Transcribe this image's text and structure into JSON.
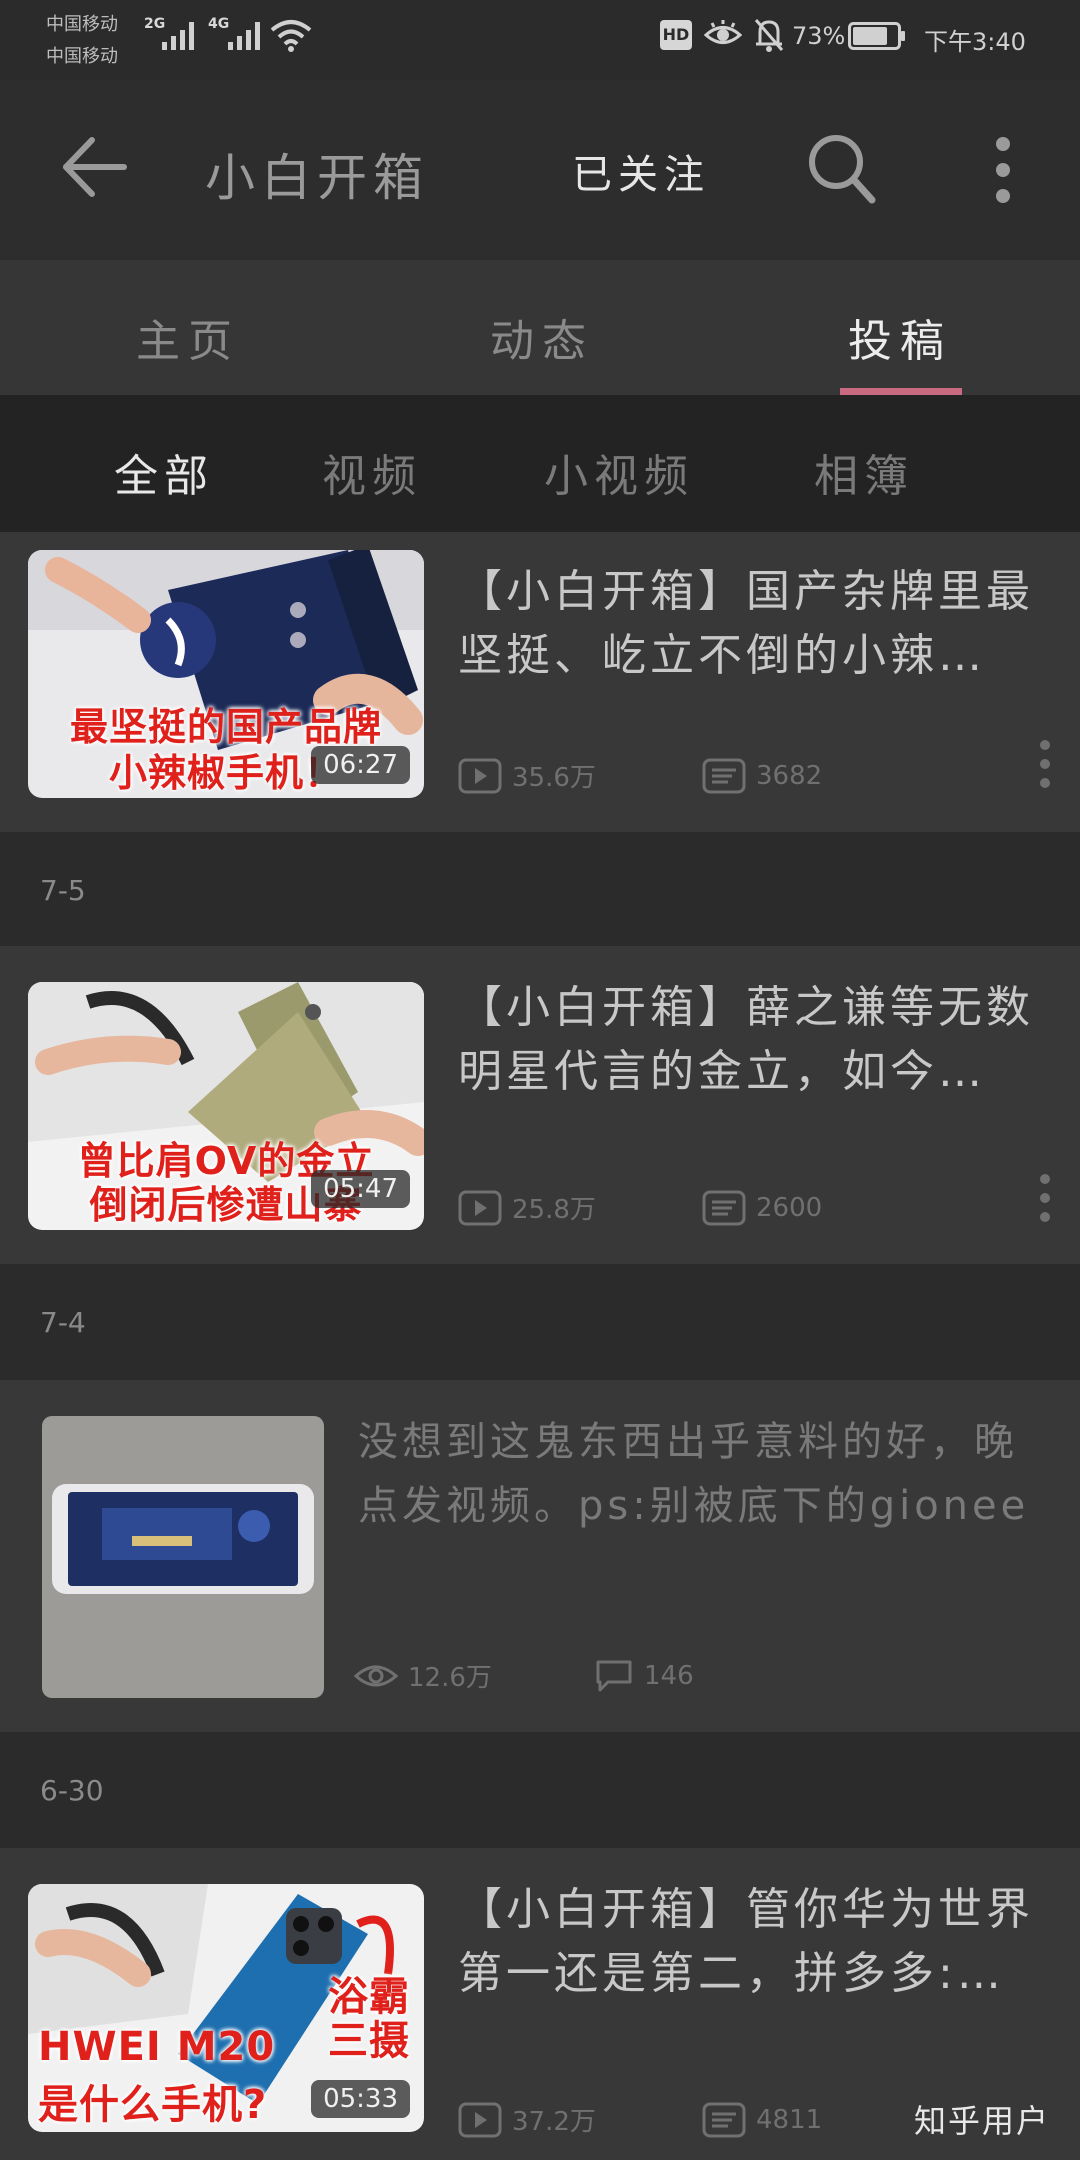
{
  "status": {
    "carrier_1": "中国移动",
    "carrier_2": "中国移动",
    "net_1": "2G",
    "net_2": "4G",
    "hd": "HD",
    "battery": "73%",
    "time": "下午3:40"
  },
  "header": {
    "title": "小白开箱",
    "follow_label": "已关注"
  },
  "main_tabs": [
    {
      "label": "主页"
    },
    {
      "label": "动态"
    },
    {
      "label": "投稿"
    }
  ],
  "sub_tabs": [
    {
      "label": "全部"
    },
    {
      "label": "视频"
    },
    {
      "label": "小视频"
    },
    {
      "label": "相簿"
    }
  ],
  "feed": [
    {
      "title": "【小白开箱】国产杂牌里最坚挺、屹立不倒的小辣…",
      "duration": "06:27",
      "caption_1": "最坚挺的国产品牌",
      "caption_2": "小辣椒手机！",
      "views": "35.6万",
      "comments": "3682"
    },
    {
      "date": "7-5",
      "title": "【小白开箱】薛之谦等无数明星代言的金立，如今…",
      "duration": "05:47",
      "caption_1": "曾比肩OV的金立",
      "caption_2": "倒闭后惨遭山寨",
      "views": "25.8万",
      "comments": "2600"
    },
    {
      "date": "7-4",
      "title": "没想到这鬼东西出乎意料的好，晚点发视频。ps:别被底下的gionee迷…",
      "views": "12.6万",
      "comments": "146"
    },
    {
      "date": "6-30",
      "title": "【小白开箱】管你华为世界第一还是第二，拼多多:…",
      "duration": "05:33",
      "caption_1": "HWEI M20",
      "caption_2": "是什么手机?",
      "badge_1": "浴霸",
      "badge_2": "三摄",
      "views": "37.2万",
      "comments": "4811"
    }
  ],
  "watermark": "知乎用户",
  "colors": {
    "accent": "#c96a80",
    "background": "#2d2d2d",
    "card": "#383838",
    "caption_red": "#e0201b"
  }
}
